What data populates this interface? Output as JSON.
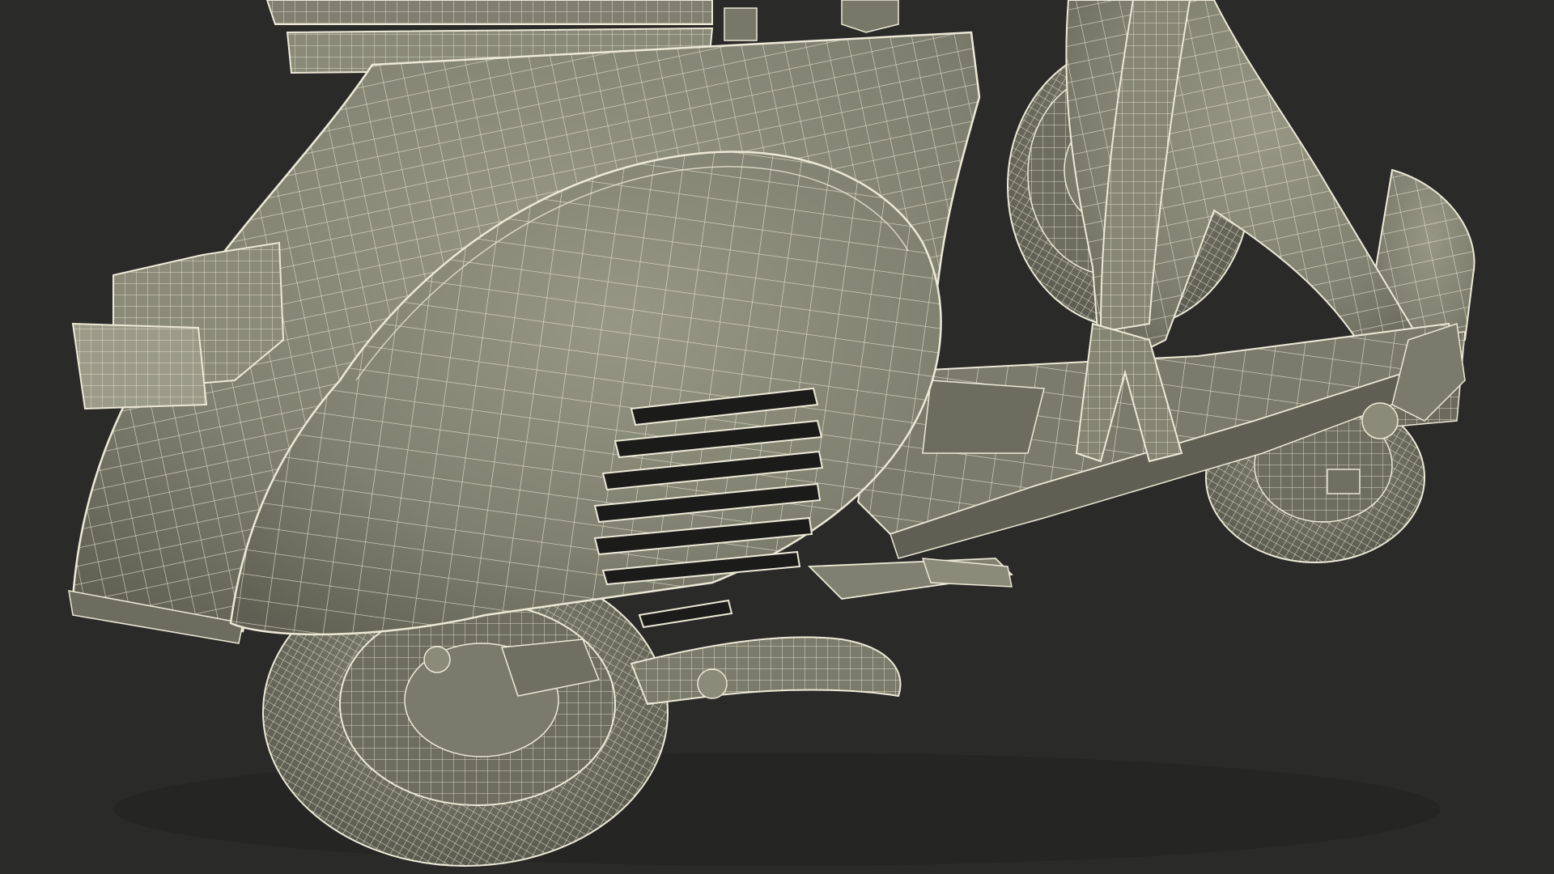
{
  "scene": {
    "subject": "scooter-wireframe-render",
    "colors": {
      "background": "#2a2a29",
      "body_fill": "#7f806f",
      "body_fill_dark": "#5f6053",
      "body_fill_light": "#969784",
      "wire": "#ece9d6",
      "shadow": "#232321",
      "vent_dark": "#1b1b1a"
    }
  }
}
